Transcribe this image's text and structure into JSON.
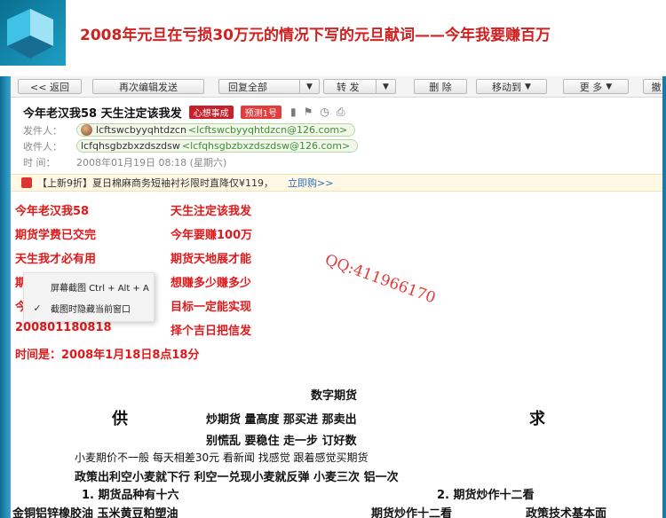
{
  "banner": {
    "title": "2008年元旦在亏损30万元的情况下写的元旦献词——今年我要赚百万"
  },
  "toolbar": {
    "back": "<< 返回",
    "edit_resend": "再次编辑发送",
    "reply_all": "回复全部",
    "forward": "转 发",
    "delete": "删 除",
    "move_to": "移动到",
    "more": "更 多",
    "withdraw": "撤"
  },
  "mail": {
    "subject": "今年老汉我58  天生注定该我发",
    "tags": [
      "心想事成",
      "预测1号"
    ],
    "from_label": "发件人：",
    "from_name": "lcftswcbyyqhtdzcn",
    "from_addr": "<lcftswcbyyqhtdzcn@126.com>",
    "to_label": "收件人：",
    "to_name": "lcfqhsgbzbxzdszdsw",
    "to_addr": "<lcfqhsgbzbxzdszdsw@126.com>",
    "time_label": "时  间：",
    "time_value": "2008年01月19日 08:18 (星期六)"
  },
  "ad": {
    "text": "【上新9折】夏日棉麻商务短袖衬衫限时直降仅¥119，",
    "link": "立即购>>"
  },
  "poem": {
    "l1a": "今年老汉我58",
    "l1b": "天生注定该我发",
    "l2a": "期货学费已交完",
    "l2b": "今年要赚100万",
    "l3a": "天生我才必有用",
    "l3b": "期货天地展才能",
    "l4a": "期",
    "l4b": "想赚多少赚多少",
    "l5a": "今",
    "l5b": "目标一定能实现",
    "l6a": "200801180818",
    "l6b": "择个吉日把信发",
    "l7": "时间是：2008年1月18日8点18分"
  },
  "watermark": "QQ:411966170",
  "context_menu": {
    "item1": "屏幕截图 Ctrl + Alt + A",
    "item2": "截图时隐藏当前窗口",
    "item2_check": "✓"
  },
  "body": {
    "heading": "数字期货",
    "left_char": "供",
    "right_char": "求",
    "line1": "炒期货  量高度   那买进  那卖出",
    "line2": "别慌乱  要稳住    走一步  订好数",
    "line3": "小麦期价不一般  每天相差30元  看新闻  找感觉  跟着感觉买期货",
    "line4": "政策出利空小麦就下行    利空一兑现小麦就反弹  小麦三次  铝一次",
    "line5a": "1. 期货品种有十六",
    "line5b": "2. 期货炒作十二看",
    "line6a": "金铜铝锌橡胶油  玉米黄豆粕塑油",
    "line6b": "期货炒作十二看",
    "line6c": "政策技术基本面"
  }
}
